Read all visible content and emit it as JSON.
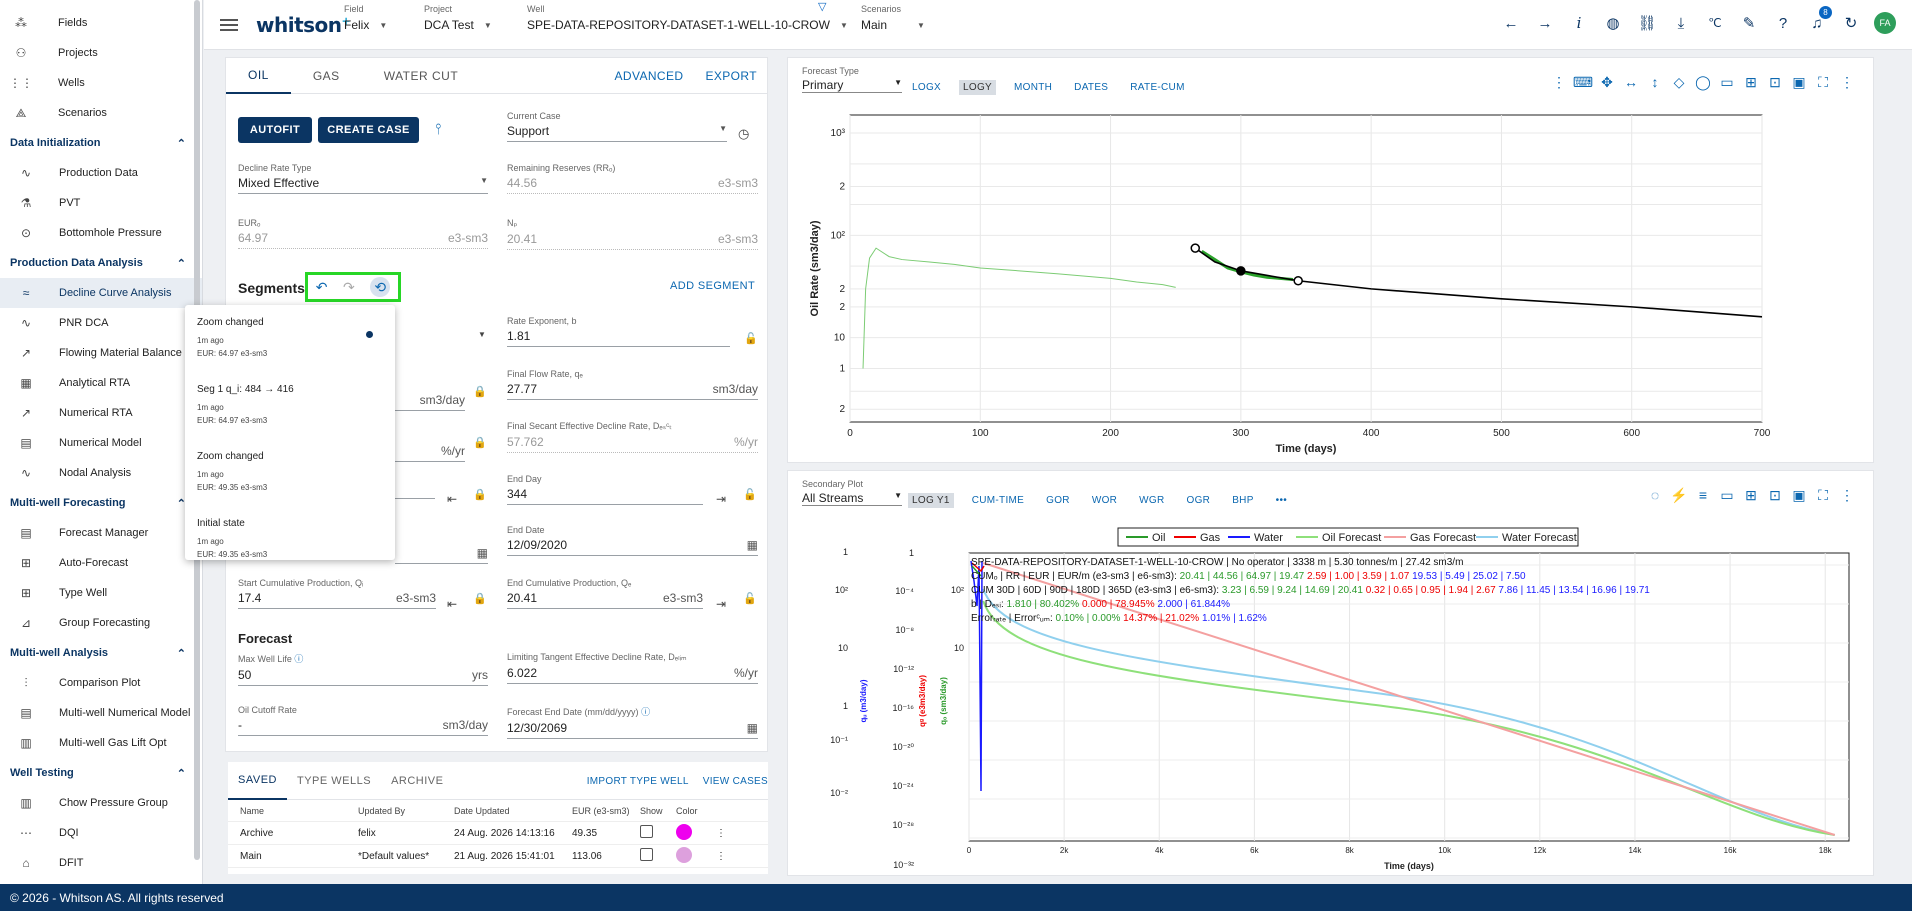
{
  "sidebar": {
    "top_items": [
      {
        "label": "Fields",
        "icon": "fields-icon"
      },
      {
        "label": "Projects",
        "icon": "projects-icon"
      },
      {
        "label": "Wells",
        "icon": "wells-icon"
      },
      {
        "label": "Scenarios",
        "icon": "scenarios-icon"
      }
    ],
    "sections": [
      {
        "title": "Data Initialization",
        "items": [
          "Production Data",
          "PVT",
          "Bottomhole Pressure"
        ]
      },
      {
        "title": "Production Data Analysis",
        "items": [
          "Decline Curve Analysis",
          "PNR DCA",
          "Flowing Material Balance",
          "Analytical RTA",
          "Numerical RTA",
          "Numerical Model",
          "Nodal Analysis"
        ]
      },
      {
        "title": "Multi-well Forecasting",
        "items": [
          "Forecast Manager",
          "Auto-Forecast",
          "Type Well",
          "Group Forecasting"
        ]
      },
      {
        "title": "Multi-well Analysis",
        "items": [
          "Comparison Plot",
          "Multi-well Numerical Model",
          "Multi-well Gas Lift Opt"
        ]
      },
      {
        "title": "Well Testing",
        "items": [
          "Chow Pressure Group",
          "DQI",
          "DFIT"
        ]
      }
    ],
    "active_item": "Decline Curve Analysis"
  },
  "topbar": {
    "logo": "whitson",
    "logo_sup": "+",
    "field_label": "Field",
    "field_value": "Felix",
    "project_label": "Project",
    "project_value": "DCA Test",
    "well_label": "Well",
    "well_value": "SPE-DATA-REPOSITORY-DATASET-1-WELL-10-CROW",
    "scenarios_label": "Scenarios",
    "scenarios_value": "Main",
    "notif_count": "8",
    "avatar": "FA"
  },
  "left": {
    "tabs": [
      "OIL",
      "GAS",
      "WATER CUT"
    ],
    "tab_links": [
      "ADVANCED",
      "EXPORT"
    ],
    "autofit": "AUTOFIT",
    "create_case": "CREATE CASE",
    "current_case_label": "Current Case",
    "current_case": "Support",
    "decline_rate_label": "Decline Rate Type",
    "decline_rate": "Mixed Effective",
    "remaining_label": "Remaining Reserves (RRₒ)",
    "remaining_value": "44.56",
    "remaining_unit": "e3-sm3",
    "eur_label": "EURₒ",
    "eur_value": "64.97",
    "eur_unit": "e3-sm3",
    "np_label": "Nₚ",
    "np_value": "20.41",
    "np_unit": "e3-sm3",
    "segments_title": "Segments",
    "add_segment": "ADD SEGMENT",
    "rate_exp_label": "Rate Exponent, b",
    "rate_exp_value": "1.81",
    "rate_unit": "sm3/day",
    "final_flow_label": "Final Flow Rate, qₑ",
    "final_flow_value": "27.77",
    "final_flow_unit": "sm3/day",
    "pct_unit": "%/yr",
    "final_secant_label": "Final Secant Effective Decline Rate, Dₑₛᶜₜ",
    "final_secant_value": "57.762",
    "final_secant_unit": "%/yr",
    "end_day_label": "End Day",
    "end_day_value": "344",
    "end_date_label": "End Date",
    "end_date_value": "12/09/2020",
    "start_cum_label": "Start Cumulative Production, Qᵢ",
    "start_cum_value": "17.4",
    "start_cum_unit": "e3-sm3",
    "end_cum_label": "End Cumulative Production, Qₑ",
    "end_cum_value": "20.41",
    "end_cum_unit": "e3-sm3",
    "forecast_title": "Forecast",
    "max_life_label": "Max Well Life",
    "max_life_value": "50",
    "max_life_unit": "yrs",
    "lim_tan_label": "Limiting Tangent Effective Decline Rate, Dₑₗᵢₘ",
    "lim_tan_value": "6.022",
    "lim_tan_unit": "%/yr",
    "cutoff_label": "Oil Cutoff Rate",
    "cutoff_value": "-",
    "cutoff_unit": "sm3/day",
    "fc_end_label": "Forecast End Date (mm/dd/yyyy)",
    "fc_end_value": "12/30/2069"
  },
  "history_popup": [
    {
      "title": "Zoom changed",
      "time": "1m ago",
      "eur": "EUR: 64.97 e3-sm3",
      "current": true
    },
    {
      "title": "Seg 1 q_i: 484 → 416",
      "time": "1m ago",
      "eur": "EUR: 64.97 e3-sm3",
      "current": false
    },
    {
      "title": "Zoom changed",
      "time": "1m ago",
      "eur": "EUR: 49.35 e3-sm3",
      "current": false
    },
    {
      "title": "Initial state",
      "time": "1m ago",
      "eur": "EUR: 49.35 e3-sm3",
      "current": false
    }
  ],
  "cases": {
    "tabs": [
      "SAVED",
      "TYPE WELLS",
      "ARCHIVE"
    ],
    "links": [
      "IMPORT TYPE WELL",
      "VIEW CASES"
    ],
    "headers": [
      "Name",
      "Updated By",
      "Date Updated",
      "EUR (e3-sm3)",
      "Show",
      "Color"
    ],
    "rows": [
      {
        "name": "Archive",
        "by": "felix",
        "date": "24 Aug. 2026 14:13:16",
        "eur": "49.35",
        "color": "#ee00ee"
      },
      {
        "name": "Main",
        "by": "*Default values*",
        "date": "21 Aug. 2026 15:41:01",
        "eur": "113.06",
        "color": "#dda0dd"
      }
    ]
  },
  "top_plot": {
    "forecast_type_label": "Forecast Type",
    "forecast_type": "Primary",
    "buttons": [
      "LOGX",
      "LOGY",
      "MONTH",
      "DATES",
      "RATE-CUM"
    ],
    "active_button": "LOGY"
  },
  "bottom_plot": {
    "secondary_label": "Secondary Plot",
    "secondary_value": "All Streams",
    "buttons": [
      "LOG Y1",
      "CUM-TIME",
      "GOR",
      "WOR",
      "WGR",
      "OGR",
      "BHP",
      "•••"
    ],
    "active_button": "LOG Y1",
    "legend": [
      "Oil",
      "Gas",
      "Water",
      "Oil Forecast",
      "Gas Forecast",
      "Water Forecast"
    ],
    "info_line1": "SPE-DATA-REPOSITORY-DATASET-1-WELL-10-CROW | No operator | 3338 m | 5.30 tonnes/m | 27.42 sm3/m",
    "info_line2a": "CUMₒ | RR | EUR | EUR/m (e3-sm3 | e6-sm3): ",
    "info_line2b": "20.41 | 44.56 | 64.97 | 19.47",
    "info_line2c": " 2.59 | 1.00 | 3.59 | 1.07",
    "info_line2d": " 19.53 | 5.49 | 25.02 | 7.50",
    "info_line3a": "CUM 30D | 60D | 90D | 180D | 365D (e3-sm3 | e6-sm3): ",
    "info_line3b": "3.23 | 6.59 | 9.24 | 14.69 | 20.41",
    "info_line3c": " 0.32 | 0.65 | 0.95 | 1.94 | 2.67",
    "info_line3d": " 7.86 | 11.45 | 13.54 | 16.96 | 19.71",
    "info_line4a": "b | Dₑₛᵢ: ",
    "info_line4b": "1.810 | 80.402%",
    "info_line4c": " 0.000 | 78.945%",
    "info_line4d": " 2.000 | 61.844%",
    "info_line5a": "Errorᵣₐₜₑ | Errorᶜᵤₘ: ",
    "info_line5b": "0.10% | 0.00%",
    "info_line5c": " 14.37% | 21.02%",
    "info_line5d": " 1.01% | 1.62%",
    "xlabel": "Time (days)",
    "ylabel_w": "qᵤ (m3/day)",
    "ylabel_g": "qᵍ (e3m3/day)",
    "ylabel_o": "qₒ (sm3/day)"
  },
  "chart_data": [
    {
      "type": "line",
      "xlabel": "Time (days)",
      "ylabel": "Oil Rate (sm3/day)",
      "xlim": [
        0,
        700
      ],
      "ylim": [
        1.5,
        1500
      ],
      "log_y": true,
      "x_ticks": [
        0,
        100,
        200,
        300,
        400,
        500,
        600,
        700
      ],
      "y_ticks": [
        "2",
        "1",
        "2",
        "10",
        "2",
        "10²",
        "2",
        "10³"
      ],
      "grid": true,
      "series": [
        {
          "values": [
            [
              10,
              5
            ],
            [
              12,
              30
            ],
            [
              15,
              60
            ],
            [
              20,
              75
            ],
            [
              30,
              62
            ],
            [
              40,
              58
            ],
            [
              60,
              55
            ],
            [
              80,
              52
            ],
            [
              100,
              48
            ],
            [
              120,
              46
            ],
            [
              140,
              44
            ],
            [
              160,
              42
            ],
            [
              180,
              40
            ],
            [
              200,
              38
            ],
            [
              220,
              35
            ],
            [
              240,
              33
            ],
            [
              250,
              31
            ]
          ]
        },
        {
          "values": [
            [
              270,
              70
            ],
            [
              280,
              58
            ],
            [
              290,
              48
            ],
            [
              300,
              44
            ],
            [
              310,
              41
            ],
            [
              320,
              39
            ],
            [
              330,
              38
            ],
            [
              340,
              37
            ]
          ]
        },
        {
          "values": [
            [
              265,
              75
            ],
            [
              280,
              55
            ],
            [
              300,
              45
            ],
            [
              344,
              36
            ],
            [
              400,
              30
            ],
            [
              500,
              24
            ],
            [
              600,
              20
            ],
            [
              700,
              16
            ]
          ]
        }
      ]
    },
    {
      "type": "line",
      "xlabel": "Time (days)",
      "xlim": [
        0,
        18500
      ],
      "x_ticks": [
        "0",
        "2k",
        "4k",
        "6k",
        "8k",
        "10k",
        "12k",
        "14k",
        "16k",
        "18k"
      ],
      "grid": true,
      "series": [
        {
          "name": "Oil",
          "values": [
            [
              0,
              1
            ],
            [
              300,
              0.5
            ]
          ]
        },
        {
          "name": "Gas",
          "values": [
            [
              0,
              1
            ],
            [
              300,
              0.5
            ]
          ]
        },
        {
          "name": "Water",
          "values": [
            [
              0,
              1
            ],
            [
              300,
              0.5
            ]
          ]
        },
        {
          "name": "Oil Forecast",
          "values": [
            [
              300,
              1
            ],
            [
              18200,
              0
            ]
          ]
        },
        {
          "name": "Gas Forecast",
          "values": [
            [
              300,
              1
            ],
            [
              18200,
              0
            ]
          ]
        },
        {
          "name": "Water Forecast",
          "values": [
            [
              300,
              1
            ],
            [
              18200,
              0
            ]
          ]
        }
      ]
    }
  ],
  "footer": "© 2026 - Whitson AS. All rights reserved"
}
